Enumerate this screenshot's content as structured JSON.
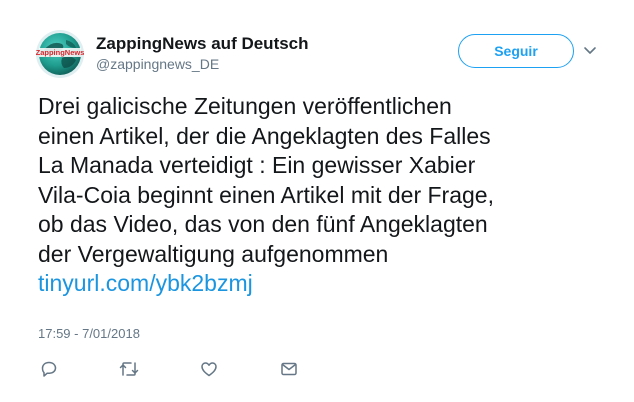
{
  "user": {
    "display_name": "ZappingNews auf Deutsch",
    "handle": "@zappingnews_DE",
    "avatar_logo_text": "ZappingNews"
  },
  "follow_button": {
    "label": "Seguir"
  },
  "tweet": {
    "text_lines": [
      "Drei galicische Zeitungen veröffentlichen",
      "einen Artikel, der die Angeklagten des Falles",
      "La Manada verteidigt : Ein gewisser Xabier",
      "Vila-Coia beginnt einen Artikel mit der Frage,",
      "ob das Video, das von den fünf Angeklagten",
      "der Vergewaltigung aufgenommen"
    ],
    "link_text": "tinyurl.com/ybk2bzmj",
    "timestamp": "17:59 - 7/01/2018"
  },
  "actions": [
    {
      "icon": "reply-icon"
    },
    {
      "icon": "retweet-icon"
    },
    {
      "icon": "like-icon"
    },
    {
      "icon": "direct-message-icon"
    }
  ],
  "colors": {
    "accent": "#1da1f2",
    "link": "#1b95e0",
    "text": "#14171a",
    "secondary_text": "#657786",
    "icon": "#657786"
  }
}
